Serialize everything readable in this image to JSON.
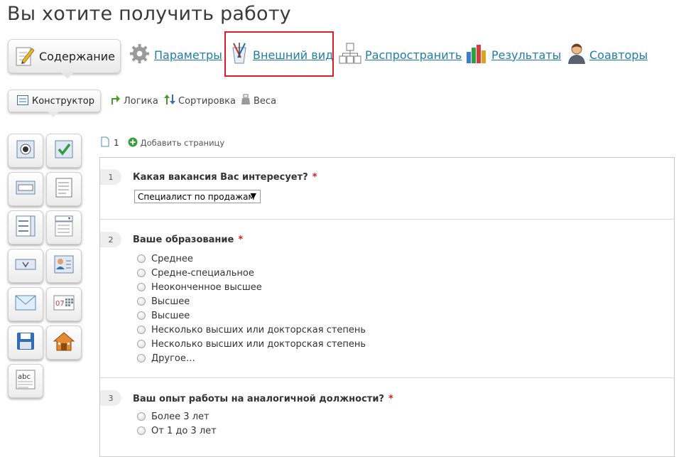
{
  "page": {
    "title": "Вы хотите получить работу"
  },
  "top_nav": {
    "content": "Содержание",
    "params": "Параметры",
    "appearance": "Внешний вид",
    "distribute": "Распространить",
    "results": "Результаты",
    "coauthors": "Соавторы"
  },
  "sub_nav": {
    "constructor": "Конструктор",
    "logic": "Логика",
    "sort": "Сортировка",
    "weights": "Веса"
  },
  "tools": [
    "radio-tool-icon",
    "checkbox-tool-icon",
    "textbox-tool-icon",
    "textarea-tool-icon",
    "listbox-tool-icon",
    "dropdown-tool-icon",
    "rating-tool-icon",
    "contact-card-tool-icon",
    "email-tool-icon",
    "date-tool-icon",
    "save-tool-icon",
    "address-tool-icon",
    "text-label-tool-icon"
  ],
  "page_bar": {
    "page_number": "1",
    "add_page": "Добавить страницу"
  },
  "questions": [
    {
      "num": "1",
      "text": "Какая вакансия Вас интересует?",
      "required": "*",
      "select_value": "Специалист по продажам"
    },
    {
      "num": "2",
      "text": "Ваше образование",
      "required": "*",
      "options": [
        "Среднее",
        "Средне-специальное",
        "Неоконченное высшее",
        "Высшее",
        "Высшее",
        "Несколько высших или докторская степень",
        "Несколько высших или докторская степень",
        "Другое…"
      ]
    },
    {
      "num": "3",
      "text": "Ваш опыт работы на аналогичной должности?",
      "required": "*",
      "options": [
        "Более 3 лет",
        "От 1 до 3 лет"
      ]
    }
  ],
  "colors": {
    "link": "#1e7ca8",
    "highlight": "#d9202a",
    "required": "#d21f1f"
  }
}
